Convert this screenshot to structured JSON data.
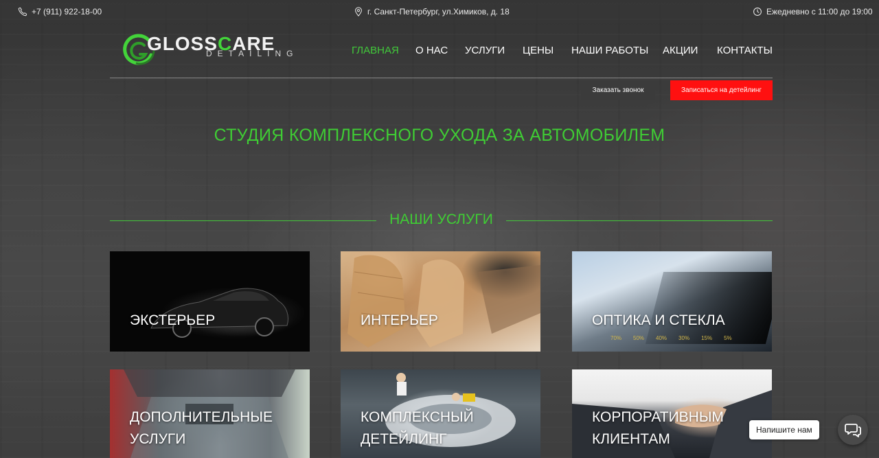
{
  "topbar": {
    "phone": "+7 (911) 922-18-00",
    "address": "г. Санкт-Петербург, ул.Химиков, д. 18",
    "hours": "Ежедневно с 11:00 до 19:00"
  },
  "logo": {
    "word_left": "GLOSS",
    "word_accent": "C",
    "word_right": "ARE",
    "sub": "DETAILING"
  },
  "nav": {
    "items": [
      "ГЛАВНАЯ",
      "О НАС",
      "УСЛУГИ",
      "ЦЕНЫ",
      "НАШИ РАБОТЫ",
      "АКЦИИ",
      "КОНТАКТЫ"
    ],
    "active": "ГЛАВНАЯ"
  },
  "buttons": {
    "call": "Заказать звонок",
    "book": "Записаться на детейлинг"
  },
  "hero": {
    "title": "СТУДИЯ КОМПЛЕКСНОГО УХОДА ЗА АВТОМОБИЛЕМ"
  },
  "services": {
    "heading": "НАШИ УСЛУГИ",
    "cards": [
      {
        "line1": "ЭКСТЕРЬЕР",
        "line2": ""
      },
      {
        "line1": "ИНТЕРЬЕР",
        "line2": ""
      },
      {
        "line1": "ОПТИКА И СТЕКЛА",
        "line2": ""
      },
      {
        "line1": "ДОПОЛНИТЕЛЬНЫЕ",
        "line2": "УСЛУГИ"
      },
      {
        "line1": "КОМПЛЕКСНЫЙ",
        "line2": "ДЕТЕЙЛИНГ"
      },
      {
        "line1": "КОРПОРАТИВНЫМ",
        "line2": "КЛИЕНТАМ"
      }
    ],
    "tint_percents": [
      "70%",
      "50%",
      "40%",
      "30%",
      "15%",
      "5%"
    ]
  },
  "chat": {
    "label": "Напишите нам"
  },
  "colors": {
    "accent_green": "#3fcd34",
    "cta_red": "#ff1010",
    "dark_button": "#3b3b3b"
  }
}
